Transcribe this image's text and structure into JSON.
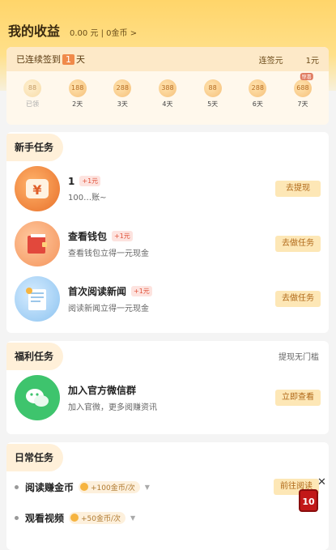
{
  "header": {
    "title": "我的收益",
    "summary": "0.00 元 | 0金币 >"
  },
  "checkin": {
    "prefix": "已连续签到",
    "days": "1",
    "suffix": "天",
    "streak_label": "连签元",
    "streak_value": "1元",
    "items": [
      {
        "coin": "88",
        "label": "已领",
        "tag": ""
      },
      {
        "coin": "188",
        "label": "2天",
        "tag": ""
      },
      {
        "coin": "288",
        "label": "3天",
        "tag": ""
      },
      {
        "coin": "388",
        "label": "4天",
        "tag": ""
      },
      {
        "coin": "88",
        "label": "5天",
        "tag": ""
      },
      {
        "coin": "288",
        "label": "6天",
        "tag": ""
      },
      {
        "coin": "688",
        "label": "7天",
        "tag": "惊喜"
      }
    ]
  },
  "novice": {
    "title": "新手任务",
    "tasks": [
      {
        "icon": "play-coin-icon",
        "name": "1",
        "reward": "+1元",
        "desc": "100…账~",
        "button": "去提现"
      },
      {
        "icon": "wallet-icon",
        "name": "查看钱包",
        "reward": "+1元",
        "desc": "查看钱包立得一元现金",
        "button": "去做任务"
      },
      {
        "icon": "newspaper-icon",
        "name": "首次阅读新闻",
        "reward": "+1元",
        "desc": "阅读新闻立得一元现金",
        "button": "去做任务"
      }
    ]
  },
  "welfare": {
    "title": "福利任务",
    "right": "提现无门槛",
    "tasks": [
      {
        "icon": "wechat-icon",
        "name": "加入官方微信群",
        "desc": "加入官微，更多阅赚资讯",
        "button": "立即查看"
      }
    ]
  },
  "daily": {
    "title": "日常任务",
    "items": [
      {
        "name": "阅读赚金币",
        "coins": "+100金币/次",
        "button": "前往阅读"
      },
      {
        "name": "观看视频",
        "coins": "+50金币/次",
        "button": ""
      }
    ]
  },
  "float": {
    "badge": "10",
    "close": "✕"
  },
  "colors": {
    "accent": "#f6c453",
    "button_bg": "#fde7b6",
    "button_text": "#b06818",
    "reward_red": "#e0523a"
  }
}
